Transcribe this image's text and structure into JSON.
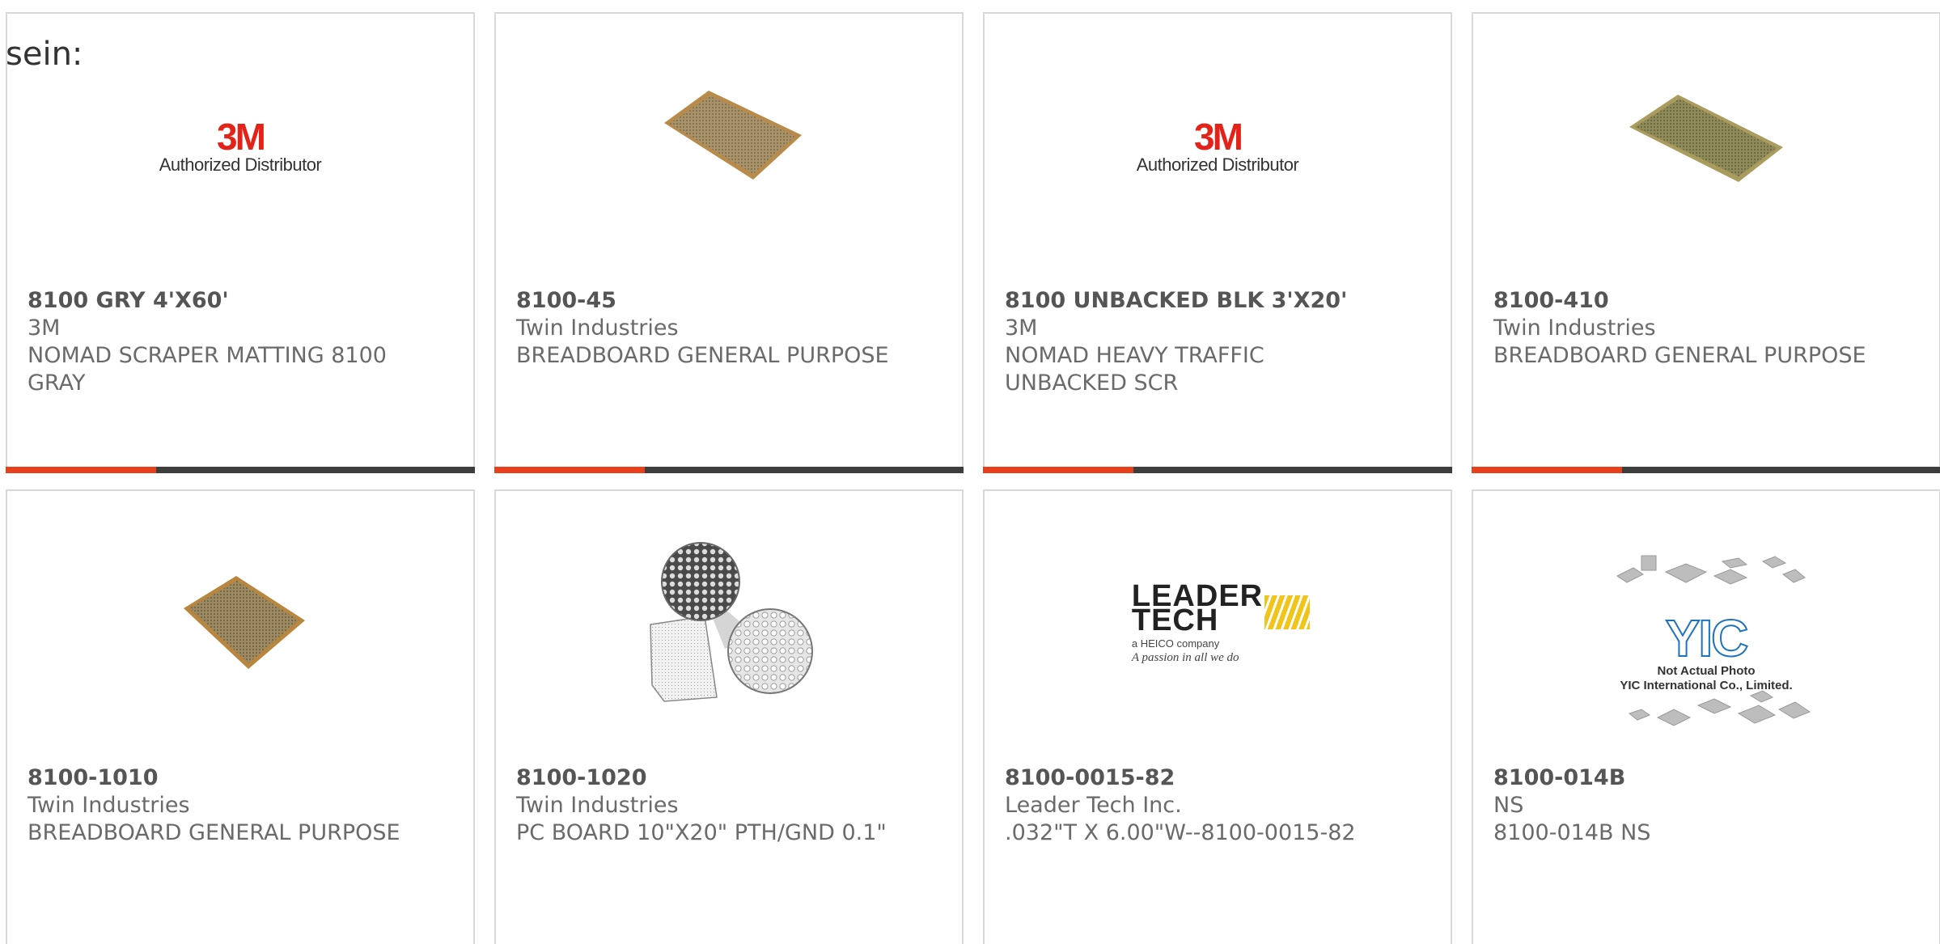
{
  "page": {
    "label": "sein:"
  },
  "products": [
    {
      "part_number": "8100 GRY 4'X60'",
      "manufacturer": "3M",
      "description": "NOMAD SCRAPER MATTING 8100 GRAY",
      "image": "3m-authorized-distributor-logo",
      "progress_fraction": 0.32
    },
    {
      "part_number": "8100-45",
      "manufacturer": "Twin Industries",
      "description": "BREADBOARD GENERAL PURPOSE",
      "image": "breadboard-photo",
      "progress_fraction": 0.32
    },
    {
      "part_number": "8100 UNBACKED BLK 3'X20'",
      "manufacturer": "3M",
      "description": "NOMAD HEAVY TRAFFIC UNBACKED SCR",
      "image": "3m-authorized-distributor-logo",
      "progress_fraction": 0.32
    },
    {
      "part_number": "8100-410",
      "manufacturer": "Twin Industries",
      "description": "BREADBOARD GENERAL PURPOSE",
      "image": "breadboard-photo",
      "progress_fraction": 0.32
    },
    {
      "part_number": "8100-1010",
      "manufacturer": "Twin Industries",
      "description": "BREADBOARD GENERAL PURPOSE",
      "image": "breadboard-photo"
    },
    {
      "part_number": "8100-1020",
      "manufacturer": "Twin Industries",
      "description": "PC BOARD 10\"X20\" PTH/GND 0.1\"",
      "image": "pc-board-detail-photo"
    },
    {
      "part_number": "8100-0015-82",
      "manufacturer": "Leader Tech Inc.",
      "description": ".032\"T X 6.00\"W--8100-0015-82",
      "image": "leader-tech-logo"
    },
    {
      "part_number": "8100-014B",
      "manufacturer": "NS",
      "description": "8100-014B NS",
      "image": "yic-not-actual-photo"
    }
  ],
  "logos": {
    "three_m": {
      "mark": "3M",
      "sub": "Authorized Distributor"
    },
    "leader_tech": {
      "word1": "LEADER",
      "word2": "TECH",
      "sub": "a HEICO company",
      "tagline": "A passion in all we do"
    },
    "yic": {
      "mark": "YIC",
      "line1": "Not Actual Photo",
      "line2": "YIC International Co., Limited."
    }
  },
  "colors": {
    "accent": "#e8401c",
    "bar": "#3d3d3d",
    "border": "#d8d8d8",
    "text": "#6a6a6a",
    "brand_3m": "#e2231a",
    "yic_blue": "#1e73be"
  }
}
